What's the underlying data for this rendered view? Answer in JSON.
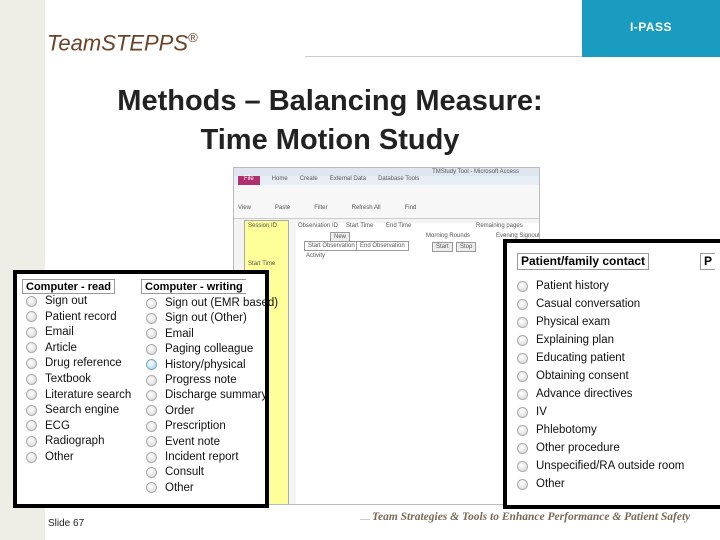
{
  "header": {
    "brand": "TeamSTEPPS",
    "brand_mark": "®",
    "program": "I-PASS",
    "program_color": "#1a9cc0"
  },
  "title": {
    "line1": "Methods – Balancing Measure:",
    "line2": "Time Motion Study"
  },
  "app": {
    "window_title": "TMStudy Tool - Microsoft Access",
    "tabs": [
      "File",
      "Home",
      "Create",
      "External Data",
      "Database Tools"
    ],
    "ribbon": [
      "View",
      "Paste",
      "Filter",
      "Refresh All",
      "Find"
    ],
    "fields": [
      "Session ID",
      "Observation ID",
      "Start Time",
      "End Time",
      "Remaining pages",
      "Morning Rounds",
      "Evening Signout",
      "Start Observation",
      "End Observation",
      "Activity",
      "Start",
      "Stop",
      "New"
    ]
  },
  "read_panel": {
    "header": "Computer - read",
    "items": [
      "Sign out",
      "Patient record",
      "Email",
      "Article",
      "Drug reference",
      "Textbook",
      "Literature search",
      "Search engine",
      "ECG",
      "Radiograph",
      "Other"
    ]
  },
  "write_panel": {
    "header": "Computer - writing",
    "selected": "History/physical",
    "items": [
      "Sign out (EMR based)",
      "Sign out (Other)",
      "Email",
      "Paging colleague",
      "History/physical",
      "Progress note",
      "Discharge summary",
      "Order",
      "Prescription",
      "Event note",
      "Incident report",
      "Consult",
      "Other"
    ]
  },
  "contact_panel": {
    "header": "Patient/family contact",
    "next_header_partial": "P",
    "items": [
      "Patient history",
      "Casual conversation",
      "Physical exam",
      "Explaining plan",
      "Educating patient",
      "Obtaining consent",
      "Advance directives",
      "IV",
      "Phlebotomy",
      "Other procedure",
      "Unspecified/RA outside room",
      "Other"
    ]
  },
  "footer": {
    "slide": "Slide 67",
    "tagline": "Team Strategies & Tools to Enhance Performance & Patient Safety"
  }
}
